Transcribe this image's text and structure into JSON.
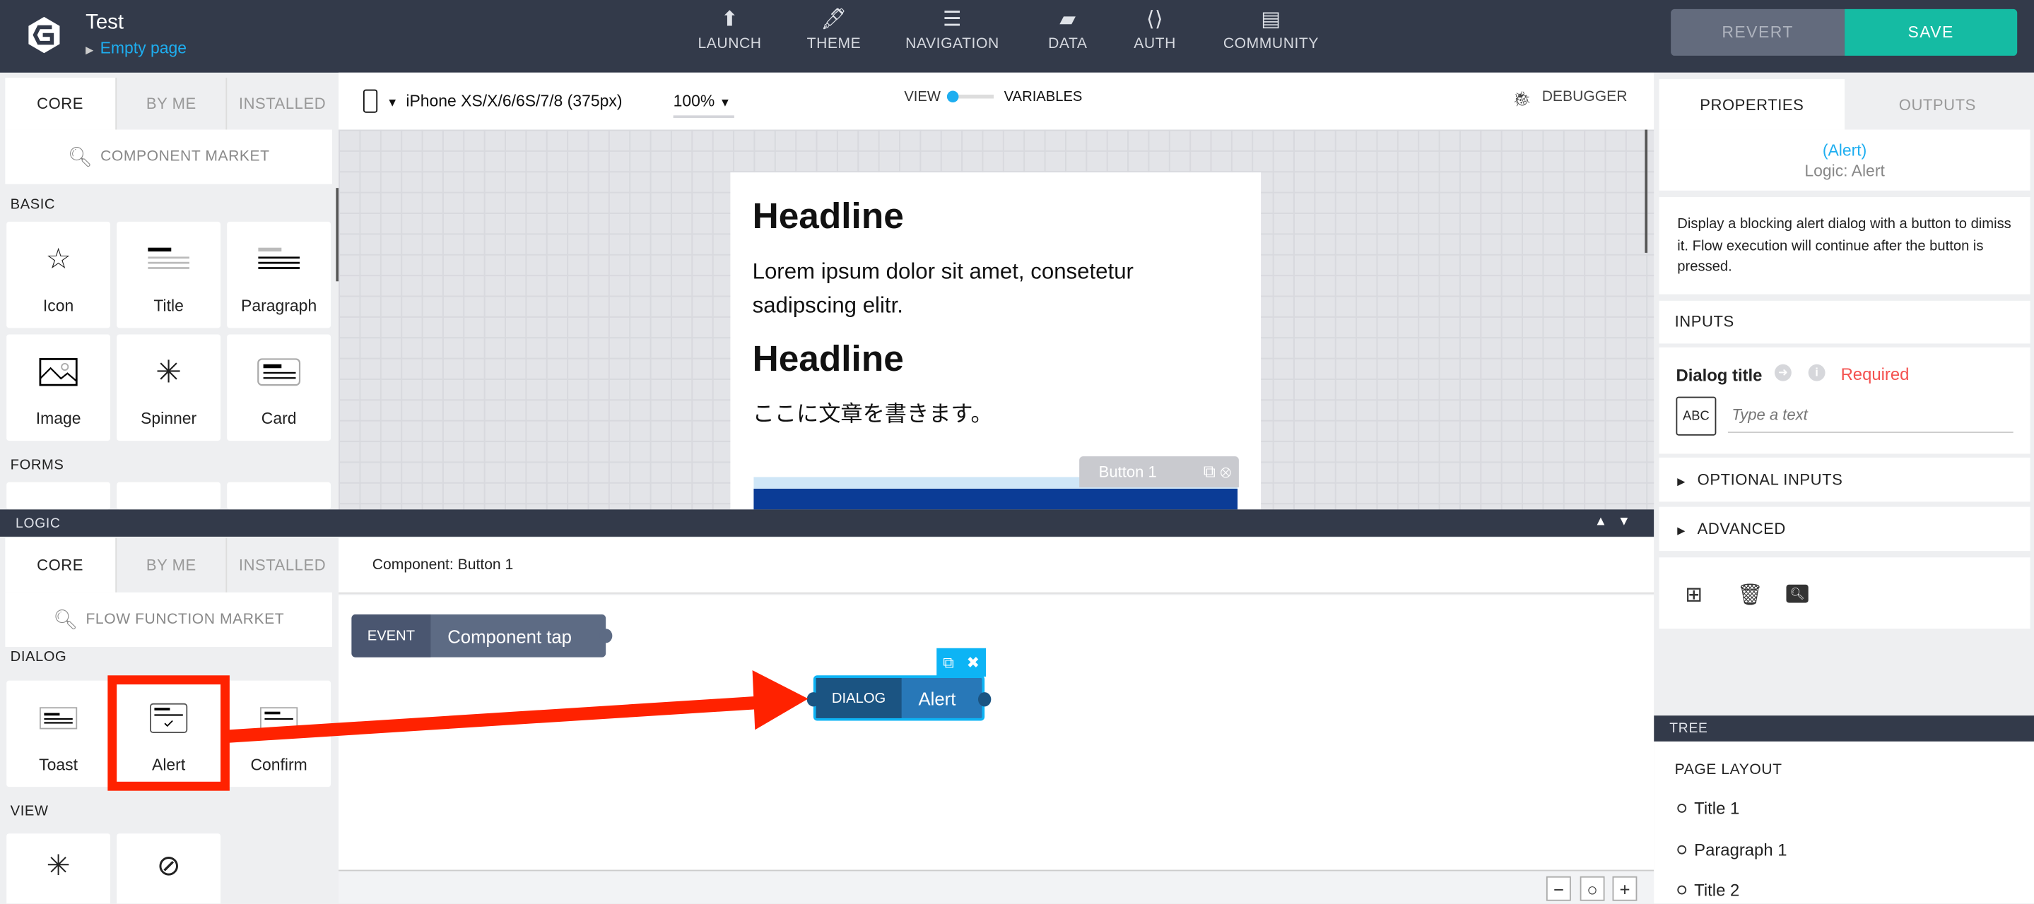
{
  "header": {
    "app_title": "Test",
    "page_name": "Empty page",
    "nav": [
      {
        "label": "LAUNCH",
        "icon": "upload-circle-icon"
      },
      {
        "label": "THEME",
        "icon": "dropper-icon"
      },
      {
        "label": "NAVIGATION",
        "icon": "list-icon"
      },
      {
        "label": "DATA",
        "icon": "folder-icon"
      },
      {
        "label": "AUTH",
        "icon": "code-file-icon"
      },
      {
        "label": "COMMUNITY",
        "icon": "chat-icon"
      }
    ],
    "revert": "REVERT",
    "save": "SAVE"
  },
  "colors": {
    "topbar": "#333a4a",
    "accent": "#1eaef0",
    "save": "#15bba3",
    "required": "#f4514f",
    "annotation": "#ff2200"
  },
  "components_panel": {
    "tabs": [
      "CORE",
      "BY ME",
      "INSTALLED"
    ],
    "search": "COMPONENT MARKET",
    "sections": [
      {
        "title": "BASIC",
        "items": [
          "Icon",
          "Title",
          "Paragraph",
          "Image",
          "Spinner",
          "Card"
        ]
      },
      {
        "title": "FORMS"
      }
    ]
  },
  "toolbar": {
    "device": "iPhone XS/X/6/6S/7/8 (375px)",
    "zoom": "100%",
    "view": "VIEW",
    "variables": "VARIABLES",
    "debugger": "DEBUGGER"
  },
  "canvas": {
    "headline1": "Headline",
    "paragraph1": "Lorem ipsum dolor sit amet, consetetur sadipscing elitr.",
    "headline2": "Headline",
    "paragraph2": "ここに文章を書きます。",
    "button_label": "Button 1"
  },
  "logic": {
    "bar_title": "LOGIC",
    "tabs": [
      "CORE",
      "BY ME",
      "INSTALLED"
    ],
    "search": "FLOW FUNCTION MARKET",
    "sections": [
      {
        "title": "DIALOG",
        "items": [
          "Toast",
          "Alert",
          "Confirm"
        ]
      },
      {
        "title": "VIEW"
      }
    ],
    "component_header": "Component: Button 1",
    "event_node": {
      "tag": "EVENT",
      "label": "Component tap"
    },
    "dialog_node": {
      "tag": "DIALOG",
      "label": "Alert"
    }
  },
  "properties": {
    "tabs": [
      "PROPERTIES",
      "OUTPUTS"
    ],
    "node_name": "(Alert)",
    "node_type": "Logic: Alert",
    "description": "Display a blocking alert dialog with a button to dimiss it. Flow execution will continue after the button is pressed.",
    "inputs_title": "INPUTS",
    "dialog_title_label": "Dialog title",
    "required": "Required",
    "type_badge": "ABC",
    "placeholder": "Type a text",
    "optional_inputs": "OPTIONAL INPUTS",
    "advanced": "ADVANCED"
  },
  "tree": {
    "title": "TREE",
    "section": "PAGE LAYOUT",
    "items": [
      "Title 1",
      "Paragraph 1",
      "Title 2"
    ]
  }
}
